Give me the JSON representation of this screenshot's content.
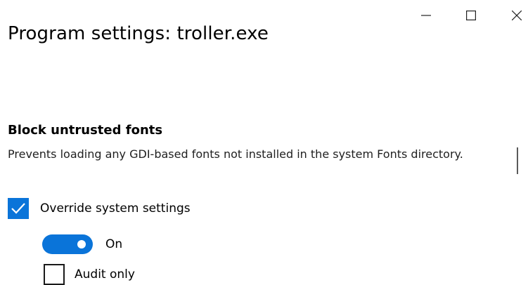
{
  "window": {
    "title": "Program settings: troller.exe",
    "controls": {
      "minimize_icon": "minimize-icon",
      "maximize_icon": "maximize-icon",
      "close_icon": "close-icon"
    }
  },
  "setting": {
    "title": "Block untrusted fonts",
    "description": "Prevents loading any GDI-based fonts not installed in the system Fonts directory.",
    "override": {
      "label": "Override system settings",
      "checked": true
    },
    "toggle": {
      "label": "On",
      "on": true
    },
    "audit": {
      "label": "Audit only",
      "checked": false
    }
  },
  "colors": {
    "accent": "#0a74d9",
    "text": "#000000"
  }
}
